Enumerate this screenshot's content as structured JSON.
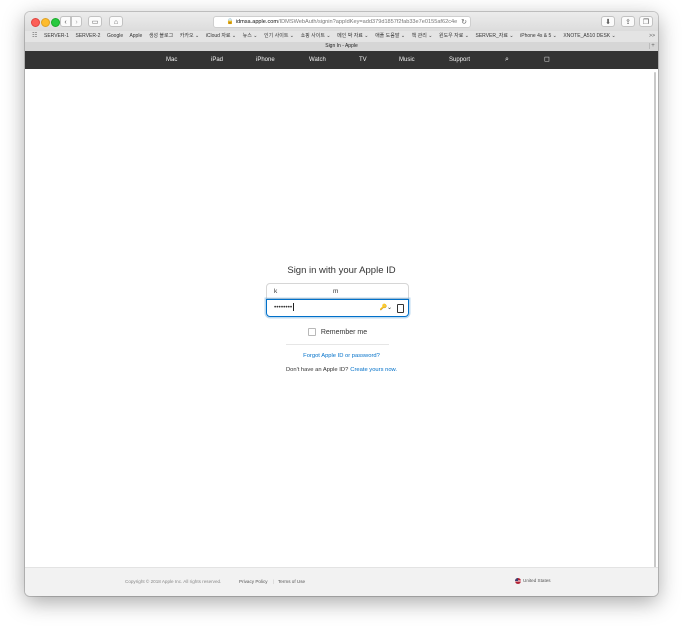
{
  "browser": {
    "address": {
      "lock": "🔒",
      "host": "idmsa.apple.com",
      "path": "/IDMSWebAuth/signin?appIdKey=add379d1857f2fab33e7e0155af62c4e",
      "reload": "↻"
    },
    "toolbar": {
      "back": "‹",
      "forward": "›",
      "sidebar": "▭",
      "home": "⌂",
      "download": "⬇",
      "share": "⇪",
      "tabs": "❐"
    },
    "bookmarks": {
      "grid": "☷",
      "items": [
        "SERVER-1",
        "SERVER-2",
        "Google",
        "Apple",
        "생성 블로그",
        "카카오 ⌄",
        "iCloud 자료 ⌄",
        "뉴스 ⌄",
        "인기 사이트 ⌄",
        "쇼핑 사이트 ⌄",
        "메인 박 자료 ⌄",
        "애플 도움말 ⌄",
        "책 관리 ⌄",
        "윈도우 자료 ⌄",
        "SERVER_자료 ⌄",
        "iPhone 4s & 5 ⌄",
        "XNOTE_A510 DESK ⌄"
      ],
      "more": ">>"
    },
    "tab": {
      "title": "Sign In - Apple",
      "plus": "+"
    }
  },
  "apple_nav": {
    "logo": "",
    "items": [
      "Mac",
      "iPad",
      "iPhone",
      "Watch",
      "TV",
      "Music",
      "Support"
    ],
    "search": "⌕",
    "bag": "◻"
  },
  "signin": {
    "title": "Sign in with your Apple ID",
    "apple_id_value": "k",
    "apple_id_value_2": "m",
    "password_value": "••••••••",
    "key_icon": "🔑⌄",
    "remember_label": "Remember me",
    "forgot_link": "Forgot Apple ID or password?",
    "no_id_text": "Don't have an Apple ID?",
    "create_link": "Create yours now."
  },
  "footer": {
    "copyright": "Copyright © 2018 Apple Inc. All rights reserved.",
    "privacy": "Privacy Policy",
    "separator": "|",
    "terms": "Terms of Use",
    "locale": "United States"
  },
  "colors": {
    "nav_bg": "#333333",
    "link": "#0070c9",
    "focus_border": "#0070c9",
    "footer_bg": "#f2f2f2"
  }
}
